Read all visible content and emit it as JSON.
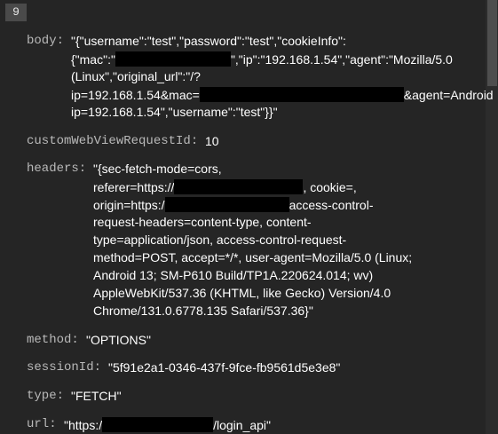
{
  "index_label": "9",
  "fields": {
    "body": {
      "key": "body:",
      "lines": [
        [
          "\"{\"username\":\"test\",\"password\":\"test\",\"cookieInfo\":"
        ],
        [
          "{\"mac\":\"",
          "\",\"ip\":\"192.168.1.54\",\"agent\":\"Mozilla/5.0"
        ],
        [
          "(Linux\",\"original_url\":\"/?"
        ],
        [
          "ip=192.168.1.54&mac=",
          "&agent=Android"
        ],
        [
          "ip=192.168.1.54\",\"username\":\"test\"}}\""
        ]
      ]
    },
    "customWebViewRequestId": {
      "key": "customWebViewRequestId:",
      "value": "10"
    },
    "headers": {
      "key": "headers:",
      "lines": [
        [
          "\"{sec-fetch-mode=cors,"
        ],
        [
          "referer=https://",
          ", cookie=,"
        ],
        [
          "origin=https:/",
          "access-control-"
        ],
        [
          "request-headers=content-type, content-"
        ],
        [
          "type=application/json, access-control-request-"
        ],
        [
          "method=POST, accept=*/*, user-agent=Mozilla/5.0 (Linux;"
        ],
        [
          "Android 13; SM-P610 Build/TP1A.220624.014; wv)"
        ],
        [
          "AppleWebKit/537.36 (KHTML, like Gecko) Version/4.0"
        ],
        [
          "Chrome/131.0.6778.135 Safari/537.36}\""
        ]
      ]
    },
    "method": {
      "key": "method:",
      "value": "\"OPTIONS\""
    },
    "sessionId": {
      "key": "sessionId:",
      "value": "\"5f91e2a1-0346-437f-9fce-fb9561d5e3e8\""
    },
    "type": {
      "key": "type:",
      "value": "\"FETCH\""
    },
    "url": {
      "key": "url:",
      "parts": [
        "\"https:/",
        "/login_api\""
      ]
    }
  }
}
